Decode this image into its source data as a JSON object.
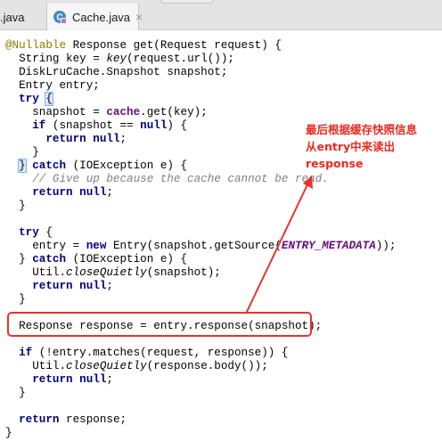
{
  "tabs": [
    {
      "label": ".java",
      "active": false
    },
    {
      "label": "Cache.java",
      "active": true,
      "close_icon": "×",
      "icon": "java-class-icon"
    }
  ],
  "code": {
    "l1": {
      "ann": "@Nullable",
      "rest": " Response get(Request request) {"
    },
    "l2": {
      "pre": "  String key = ",
      "it": "key",
      "post": "(request.url());"
    },
    "l3": {
      "text": "  DiskLruCache.Snapshot snapshot;"
    },
    "l4": {
      "text": "  Entry entry;"
    },
    "l5": {
      "kw": "try",
      "brace": "{"
    },
    "l6": {
      "pre": "    snapshot = ",
      "field": "cache",
      "post": ".get(key);"
    },
    "l7": {
      "kw": "if",
      "mid": " (snapshot == ",
      "kw2": "null",
      "post": ") {"
    },
    "l8": {
      "kw": "return",
      "kw2": "null",
      "post": ";"
    },
    "l9": {
      "text": "    }"
    },
    "l10": {
      "brace": "}",
      "kw": "catch",
      "post": " (IOException e) {"
    },
    "l11": {
      "comment": "    // Give up because the cache cannot be read."
    },
    "l12": {
      "kw": "return",
      "kw2": "null",
      "post": ";"
    },
    "l13": {
      "text": "  }"
    },
    "l14": {
      "text": ""
    },
    "l15": {
      "kw": "try",
      "post": " {"
    },
    "l16": {
      "pre": "    entry = ",
      "kw": "new",
      "mid": " Entry(snapshot.getSource(",
      "const": "ENTRY_METADATA",
      "post": "));"
    },
    "l17": {
      "kw": "catch",
      "post": " (IOException e) {"
    },
    "l18": {
      "pre": "    Util.",
      "it": "closeQuietly",
      "post": "(snapshot);"
    },
    "l19": {
      "kw": "return",
      "kw2": "null",
      "post": ";"
    },
    "l20": {
      "text": "  }"
    },
    "l21": {
      "text": ""
    },
    "l22": {
      "text": "  Response response = entry.response(snapshot);"
    },
    "l23": {
      "text": ""
    },
    "l24": {
      "kw": "if",
      "post": " (!entry.matches(request, response)) {"
    },
    "l25": {
      "pre": "    Util.",
      "it": "closeQuietly",
      "post": "(response.body());"
    },
    "l26": {
      "kw": "return",
      "kw2": "null",
      "post": ";"
    },
    "l27": {
      "text": "  }"
    },
    "l28": {
      "text": ""
    },
    "l29": {
      "kw": "return",
      "post": " response;"
    },
    "l30": {
      "text": "}"
    }
  },
  "annotation": {
    "line1": "最后根据缓存快照信息",
    "line2": "从entry中来读出",
    "line3": "response",
    "color": "#ea2a20"
  },
  "colors": {
    "keyword": "#000080",
    "annotation_type": "#808000",
    "comment": "#808080",
    "constant": "#660e7a",
    "highlight_box": "#e8322c"
  }
}
